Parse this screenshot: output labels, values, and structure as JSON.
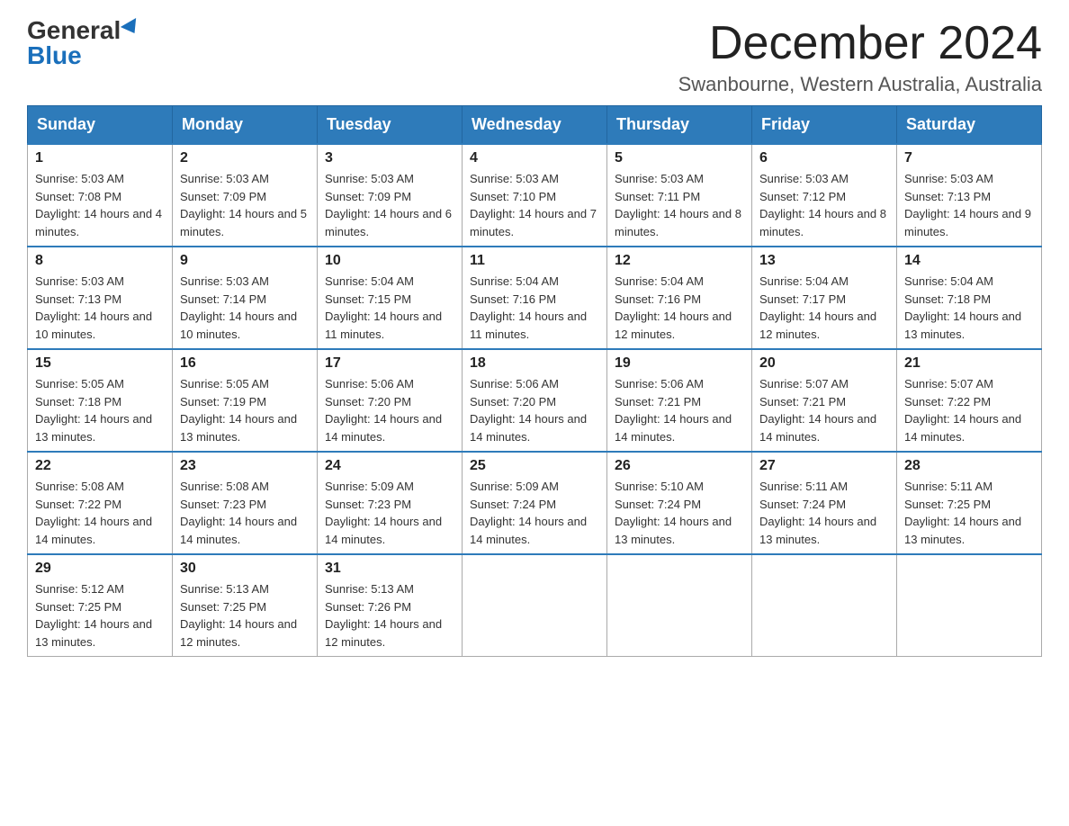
{
  "logo": {
    "general": "General",
    "blue": "Blue"
  },
  "title": {
    "month_year": "December 2024",
    "location": "Swanbourne, Western Australia, Australia"
  },
  "weekdays": [
    "Sunday",
    "Monday",
    "Tuesday",
    "Wednesday",
    "Thursday",
    "Friday",
    "Saturday"
  ],
  "weeks": [
    [
      {
        "day": "1",
        "sunrise": "5:03 AM",
        "sunset": "7:08 PM",
        "daylight": "14 hours and 4 minutes."
      },
      {
        "day": "2",
        "sunrise": "5:03 AM",
        "sunset": "7:09 PM",
        "daylight": "14 hours and 5 minutes."
      },
      {
        "day": "3",
        "sunrise": "5:03 AM",
        "sunset": "7:09 PM",
        "daylight": "14 hours and 6 minutes."
      },
      {
        "day": "4",
        "sunrise": "5:03 AM",
        "sunset": "7:10 PM",
        "daylight": "14 hours and 7 minutes."
      },
      {
        "day": "5",
        "sunrise": "5:03 AM",
        "sunset": "7:11 PM",
        "daylight": "14 hours and 8 minutes."
      },
      {
        "day": "6",
        "sunrise": "5:03 AM",
        "sunset": "7:12 PM",
        "daylight": "14 hours and 8 minutes."
      },
      {
        "day": "7",
        "sunrise": "5:03 AM",
        "sunset": "7:13 PM",
        "daylight": "14 hours and 9 minutes."
      }
    ],
    [
      {
        "day": "8",
        "sunrise": "5:03 AM",
        "sunset": "7:13 PM",
        "daylight": "14 hours and 10 minutes."
      },
      {
        "day": "9",
        "sunrise": "5:03 AM",
        "sunset": "7:14 PM",
        "daylight": "14 hours and 10 minutes."
      },
      {
        "day": "10",
        "sunrise": "5:04 AM",
        "sunset": "7:15 PM",
        "daylight": "14 hours and 11 minutes."
      },
      {
        "day": "11",
        "sunrise": "5:04 AM",
        "sunset": "7:16 PM",
        "daylight": "14 hours and 11 minutes."
      },
      {
        "day": "12",
        "sunrise": "5:04 AM",
        "sunset": "7:16 PM",
        "daylight": "14 hours and 12 minutes."
      },
      {
        "day": "13",
        "sunrise": "5:04 AM",
        "sunset": "7:17 PM",
        "daylight": "14 hours and 12 minutes."
      },
      {
        "day": "14",
        "sunrise": "5:04 AM",
        "sunset": "7:18 PM",
        "daylight": "14 hours and 13 minutes."
      }
    ],
    [
      {
        "day": "15",
        "sunrise": "5:05 AM",
        "sunset": "7:18 PM",
        "daylight": "14 hours and 13 minutes."
      },
      {
        "day": "16",
        "sunrise": "5:05 AM",
        "sunset": "7:19 PM",
        "daylight": "14 hours and 13 minutes."
      },
      {
        "day": "17",
        "sunrise": "5:06 AM",
        "sunset": "7:20 PM",
        "daylight": "14 hours and 14 minutes."
      },
      {
        "day": "18",
        "sunrise": "5:06 AM",
        "sunset": "7:20 PM",
        "daylight": "14 hours and 14 minutes."
      },
      {
        "day": "19",
        "sunrise": "5:06 AM",
        "sunset": "7:21 PM",
        "daylight": "14 hours and 14 minutes."
      },
      {
        "day": "20",
        "sunrise": "5:07 AM",
        "sunset": "7:21 PM",
        "daylight": "14 hours and 14 minutes."
      },
      {
        "day": "21",
        "sunrise": "5:07 AM",
        "sunset": "7:22 PM",
        "daylight": "14 hours and 14 minutes."
      }
    ],
    [
      {
        "day": "22",
        "sunrise": "5:08 AM",
        "sunset": "7:22 PM",
        "daylight": "14 hours and 14 minutes."
      },
      {
        "day": "23",
        "sunrise": "5:08 AM",
        "sunset": "7:23 PM",
        "daylight": "14 hours and 14 minutes."
      },
      {
        "day": "24",
        "sunrise": "5:09 AM",
        "sunset": "7:23 PM",
        "daylight": "14 hours and 14 minutes."
      },
      {
        "day": "25",
        "sunrise": "5:09 AM",
        "sunset": "7:24 PM",
        "daylight": "14 hours and 14 minutes."
      },
      {
        "day": "26",
        "sunrise": "5:10 AM",
        "sunset": "7:24 PM",
        "daylight": "14 hours and 13 minutes."
      },
      {
        "day": "27",
        "sunrise": "5:11 AM",
        "sunset": "7:24 PM",
        "daylight": "14 hours and 13 minutes."
      },
      {
        "day": "28",
        "sunrise": "5:11 AM",
        "sunset": "7:25 PM",
        "daylight": "14 hours and 13 minutes."
      }
    ],
    [
      {
        "day": "29",
        "sunrise": "5:12 AM",
        "sunset": "7:25 PM",
        "daylight": "14 hours and 13 minutes."
      },
      {
        "day": "30",
        "sunrise": "5:13 AM",
        "sunset": "7:25 PM",
        "daylight": "14 hours and 12 minutes."
      },
      {
        "day": "31",
        "sunrise": "5:13 AM",
        "sunset": "7:26 PM",
        "daylight": "14 hours and 12 minutes."
      },
      null,
      null,
      null,
      null
    ]
  ],
  "labels": {
    "sunrise": "Sunrise:",
    "sunset": "Sunset:",
    "daylight": "Daylight:"
  }
}
